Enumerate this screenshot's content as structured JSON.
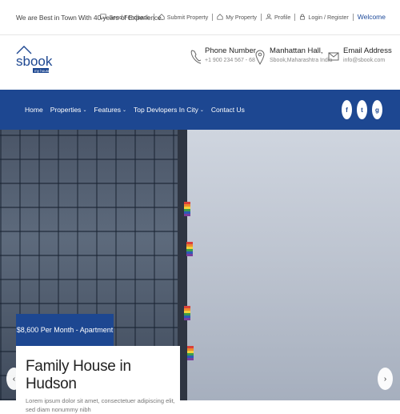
{
  "topbar": {
    "tagline": "We are Best in Town With 40 years of Experience.",
    "links": [
      {
        "icon": "chat-icon",
        "label": "Send Feedback"
      },
      {
        "icon": "home-icon",
        "label": "Submit Property"
      },
      {
        "icon": "home-icon",
        "label": "My Property"
      },
      {
        "icon": "user-icon",
        "label": "Profile"
      },
      {
        "icon": "lock-icon",
        "label": "Login / Register"
      }
    ],
    "welcome": "Welcome"
  },
  "logo": {
    "text": "sbook",
    "sub": "my house"
  },
  "contact": {
    "phone": {
      "title": "Phone Number",
      "value": "+1 900 234 567 - 68",
      "icon": "phone-icon"
    },
    "address": {
      "title": "Manhattan Hall,",
      "value": "Sbook,Maharashtra India",
      "icon": "map-pin-icon"
    },
    "email": {
      "title": "Email Address",
      "value": "info@sbook.com",
      "icon": "envelope-icon"
    }
  },
  "nav": {
    "items": [
      {
        "label": "Home",
        "dropdown": false
      },
      {
        "label": "Properties",
        "dropdown": true
      },
      {
        "label": "Features",
        "dropdown": true
      },
      {
        "label": "Top Devlopers In City",
        "dropdown": true
      },
      {
        "label": "Contact Us",
        "dropdown": false
      }
    ],
    "social": [
      "f",
      "t",
      "g"
    ]
  },
  "hero": {
    "price": "$8,600 Per Month - Apartment",
    "title": "Family House in Hudson",
    "text": "Lorem ipsum dolor sit amet, consectetuer adipiscing elit, sed diam nonummy nibh"
  },
  "colors": {
    "brand": "#1d4791"
  }
}
